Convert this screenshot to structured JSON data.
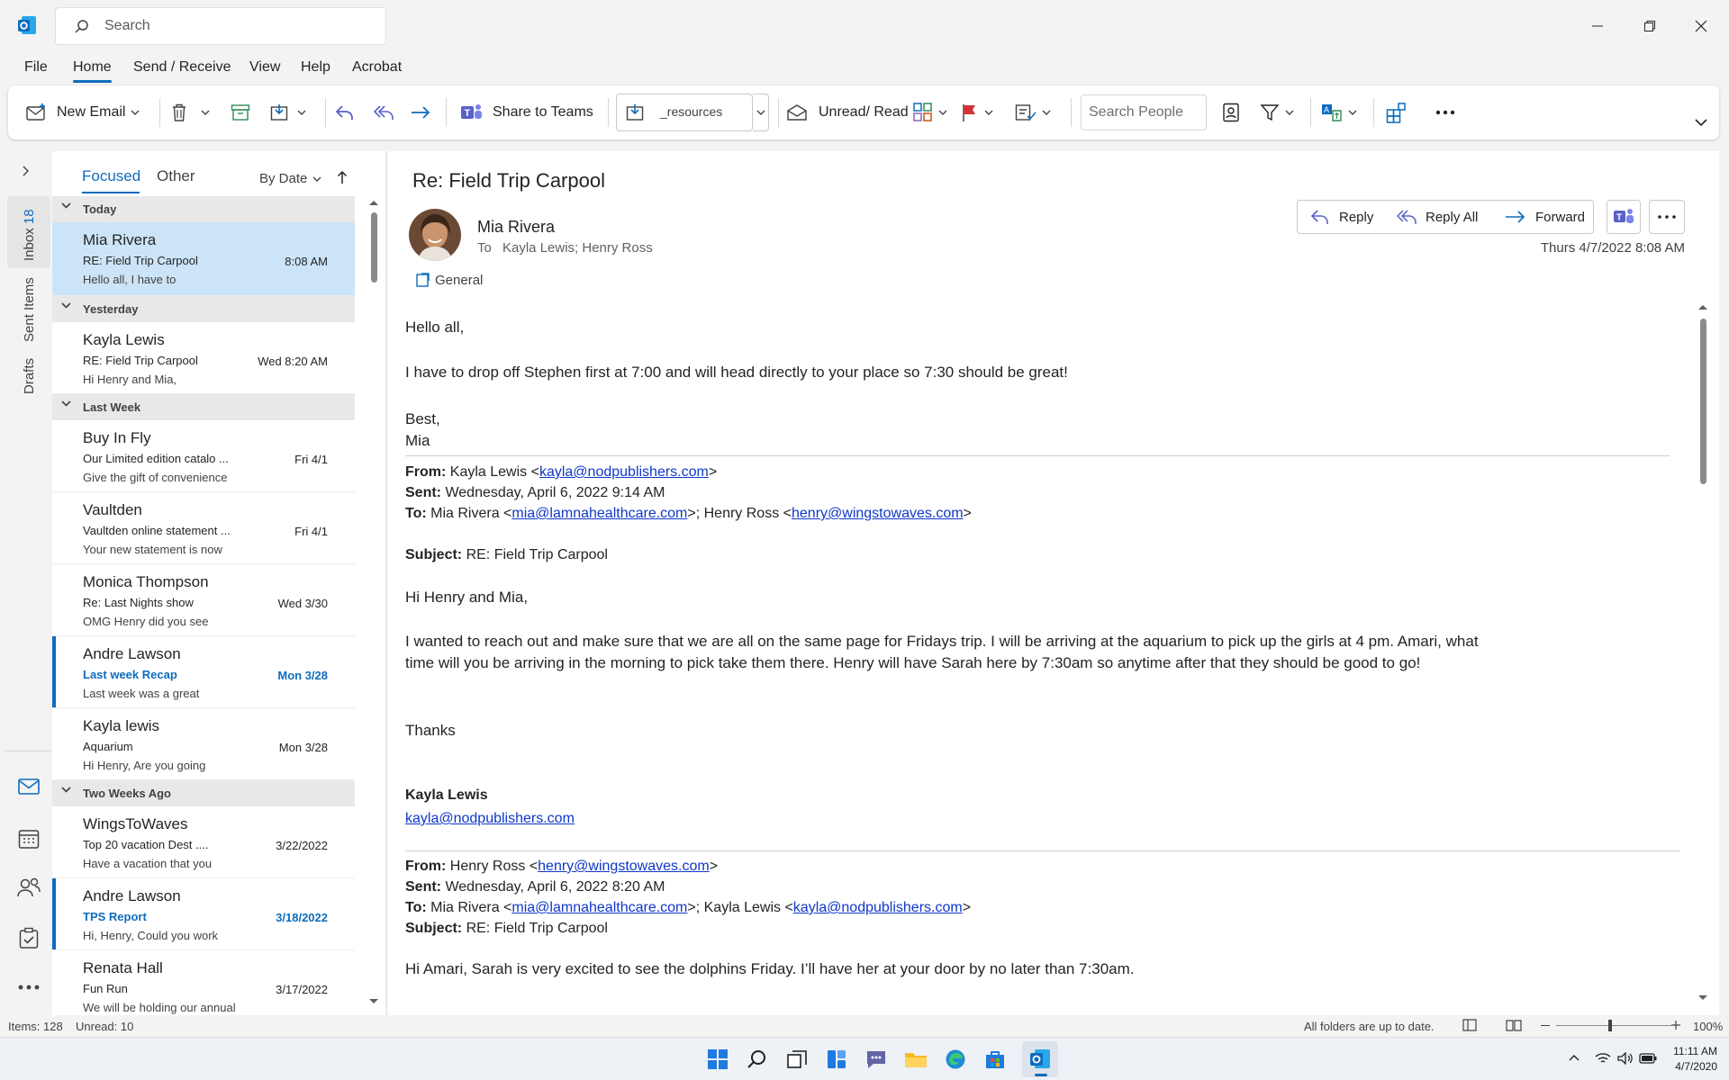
{
  "titlebar": {
    "search_placeholder": "Search"
  },
  "menu": [
    "File",
    "Home",
    "Send / Receive",
    "View",
    "Help",
    "Acrobat"
  ],
  "ribbon": {
    "new_email": "New Email",
    "share_teams": "Share to Teams",
    "move_folder": "_resources",
    "unread_read": "Unread/ Read",
    "search_people_placeholder": "Search People"
  },
  "nav": {
    "inbox": "Inbox",
    "inbox_count": "18",
    "sent": "Sent Items",
    "drafts": "Drafts"
  },
  "list": {
    "tab_focused": "Focused",
    "tab_other": "Other",
    "sort": "By Date",
    "groups": [
      "Today",
      "Yesterday",
      "Last Week",
      "Two Weeks Ago"
    ],
    "items": [
      {
        "from": "Mia Rivera",
        "subject": "RE: Field Trip Carpool",
        "preview": "Hello all,    I have to",
        "date": "8:08 AM"
      },
      {
        "from": "Kayla Lewis",
        "subject": "RE: Field Trip Carpool",
        "preview": "Hi Henry and Mia,",
        "date": "Wed 8:20 AM"
      },
      {
        "from": "Buy In Fly",
        "subject": "Our Limited edition catalo ...",
        "preview": "Give the gift of convenience",
        "date": "Fri 4/1"
      },
      {
        "from": "Vaultden",
        "subject": "Vaultden online statement ...",
        "preview": "Your new statement is now",
        "date": "Fri 4/1"
      },
      {
        "from": "Monica Thompson",
        "subject": "Re: Last Nights show",
        "preview": "OMG Henry did you see",
        "date": "Wed 3/30"
      },
      {
        "from": "Andre Lawson",
        "subject": "Last week Recap",
        "preview": "Last week was a great",
        "date": "Mon 3/28"
      },
      {
        "from": "Kayla lewis",
        "subject": "Aquarium",
        "preview": "Hi Henry,   Are you going",
        "date": "Mon 3/28"
      },
      {
        "from": "WingsToWaves",
        "subject": "Top 20 vacation Dest ....",
        "preview": "Have a vacation that you",
        "date": "3/22/2022"
      },
      {
        "from": "Andre Lawson",
        "subject": "TPS Report",
        "preview": "Hi, Henry,  Could you work",
        "date": "3/18/2022"
      },
      {
        "from": "Renata Hall",
        "subject": "Fun Run",
        "preview": "We will be holding our annual",
        "date": "3/17/2022"
      }
    ]
  },
  "message": {
    "subject": "Re: Field Trip Carpool",
    "sender": "Mia Rivera",
    "to_label": "To",
    "to": "Kayla Lewis; Henry Ross",
    "category": "General",
    "received": "Thurs 4/7/2022 8:08 AM",
    "btn_reply": "Reply",
    "btn_reply_all": "Reply All",
    "btn_forward": "Forward",
    "body": {
      "greeting": "Hello all,",
      "line1": "I have to drop off Stephen first at 7:00 and will head directly to your place so 7:30 should be great!",
      "closing": "Best,",
      "sign": "Mia"
    },
    "quote1": {
      "from_label": "From:",
      "from_name": "Kayla Lewis <",
      "from_email": "kayla@nodpublishers.com",
      "sent_label": "Sent:",
      "sent": "Wednesday, April 6, 2022 9:14 AM",
      "to_label": "To:",
      "to_name1": "Mia Rivera <",
      "to_email1": "mia@lamnahealthcare.com",
      "to_name2": ">; Henry Ross <",
      "to_email2": "henry@wingstowaves.com",
      "subject_label": "Subject:",
      "subject": "RE: Field Trip Carpool",
      "greeting": "Hi Henry and Mia,",
      "para1": "I wanted to reach out and make sure that we are all on the same page for Fridays trip. I will be arriving at the aquarium to pick up the girls at 4 pm. Amari, what",
      "para2": "time will you be arriving in the morning to pick take them there. Henry will have Sarah here by 7:30am so anytime after that they should be good to go!",
      "thanks": "Thanks",
      "sig_name": "Kayla Lewis",
      "sig_email": "kayla@nodpublishers.com"
    },
    "quote2": {
      "from_label": "From:",
      "from_name": " Henry Ross <",
      "from_email": "henry@wingstowaves.com",
      "sent_label": "Sent:",
      "sent": "Wednesday, April 6, 2022 8:20 AM",
      "to_label": "To:",
      "to_name1": "Mia Rivera <",
      "to_email1": "mia@lamnahealthcare.com",
      "to_name2": ">; Kayla Lewis <",
      "to_email2": "kayla@nodpublishers.com",
      "subject_label": "Subject:",
      "subject": "RE: Field Trip Carpool",
      "para1": "Hi Amari, Sarah is very excited to see the dolphins Friday. I’ll have her at your door by no later than 7:30am."
    }
  },
  "status": {
    "items": "Items: 128",
    "unread": "Unread: 10",
    "sync": "All folders are up to date.",
    "zoom": "100%"
  },
  "taskbar": {
    "time": "11:11 AM",
    "date": "4/7/2020"
  },
  "colors": {
    "accent": "#0f6cbd",
    "selected": "#cce4f7",
    "link": "#0f37c8"
  }
}
